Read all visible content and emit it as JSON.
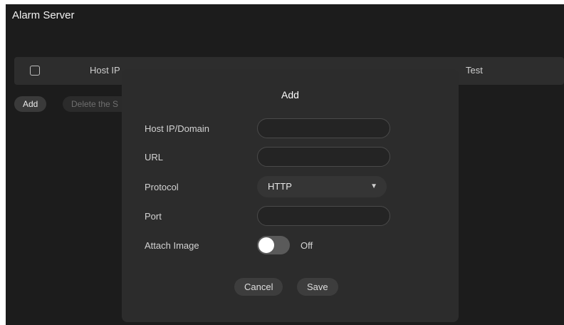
{
  "page": {
    "title": "Alarm Server"
  },
  "table": {
    "columns": [
      "Host IP",
      "Test"
    ]
  },
  "toolbar": {
    "add_label": "Add",
    "delete_label": "Delete the S"
  },
  "dialog": {
    "title": "Add",
    "fields": {
      "host_label": "Host IP/Domain",
      "host_value": "",
      "url_label": "URL",
      "url_value": "",
      "protocol_label": "Protocol",
      "protocol_value": "HTTP",
      "port_label": "Port",
      "port_value": "",
      "attach_label": "Attach Image",
      "attach_state": "Off"
    },
    "buttons": {
      "cancel": "Cancel",
      "save": "Save"
    }
  },
  "icons": {
    "select_caret": "caret-down-icon",
    "checkbox": "checkbox-icon"
  },
  "colors": {
    "background": "#1c1c1c",
    "panel": "#2c2c2c",
    "text": "#d3d3d3"
  }
}
